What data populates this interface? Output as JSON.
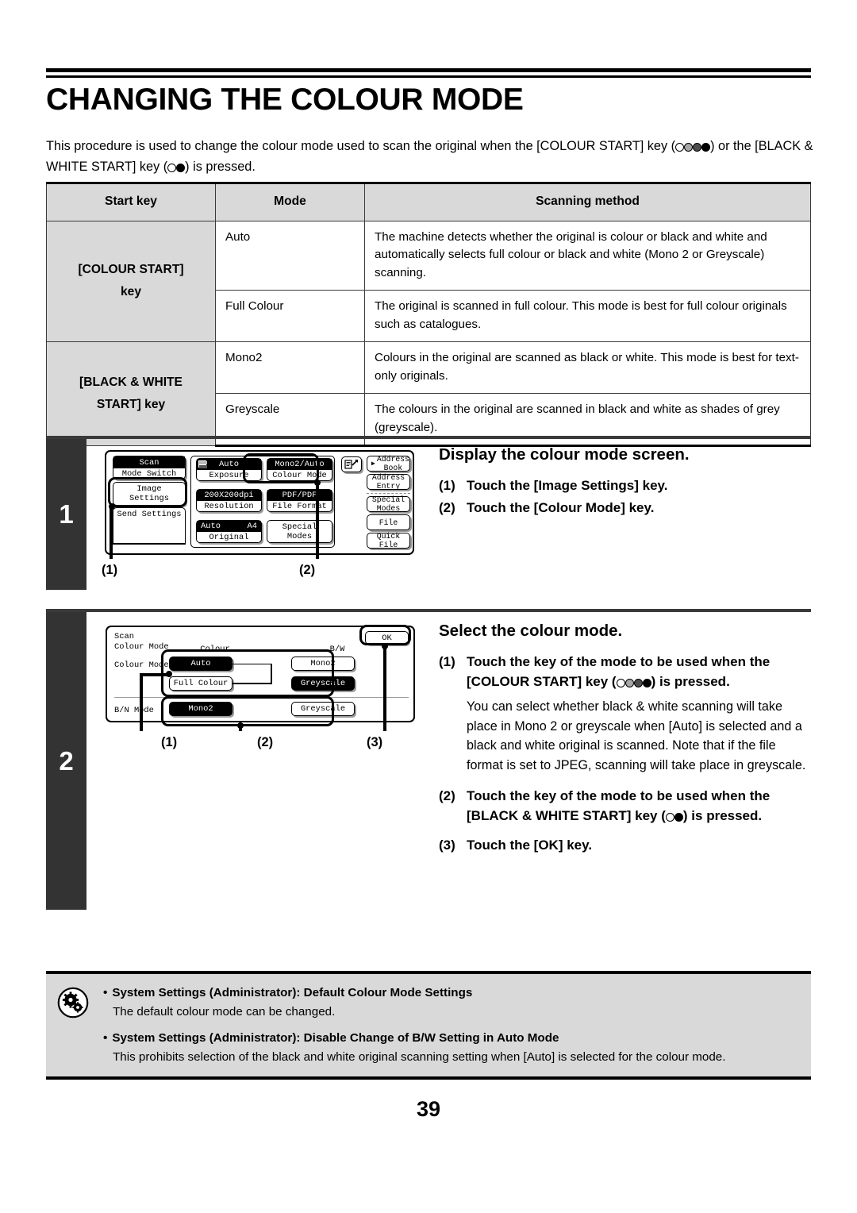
{
  "page": {
    "title": "CHANGING THE COLOUR MODE",
    "number": "39",
    "intro_a": "This procedure is used to change the colour mode used to scan the original when the [COLOUR START] key (",
    "intro_b": ") or the [BLACK & WHITE START] key (",
    "intro_c": ") is pressed."
  },
  "table": {
    "headers": [
      "Start key",
      "Mode",
      "Scanning method"
    ],
    "rows": [
      {
        "start_key": "[COLOUR START]\nkey",
        "start_key_line1": "[COLOUR START]",
        "start_key_line2": "key",
        "modes": [
          {
            "mode": "Auto",
            "method": "The machine detects whether the original is colour or black and white and automatically selects full colour or black and white (Mono 2 or Greyscale) scanning."
          },
          {
            "mode": "Full Colour",
            "method": "The original is scanned in full colour. This mode is best for full colour originals such as catalogues."
          }
        ]
      },
      {
        "start_key_line1": "[BLACK & WHITE",
        "start_key_line2": "START] key",
        "modes": [
          {
            "mode": "Mono2",
            "method": "Colours in the original are scanned as black or white. This mode is best for text-only originals."
          },
          {
            "mode": "Greyscale",
            "method": "The colours in the original are scanned in black and white as shades of grey (greyscale)."
          }
        ]
      }
    ]
  },
  "steps": [
    {
      "badge": "1",
      "heading": "Display the colour mode screen.",
      "items": [
        {
          "num": "(1)",
          "text": "Touch the [Image Settings] key."
        },
        {
          "num": "(2)",
          "text": "Touch the [Colour Mode] key."
        }
      ],
      "callouts": [
        "(1)",
        "(2)"
      ],
      "screen": {
        "left_keys": [
          {
            "top": "Scan",
            "bottom": "Mode Switch"
          },
          {
            "label_line1": "Image",
            "label_line2": "Settings"
          },
          {
            "label": "Send Settings"
          }
        ],
        "mid_keys": [
          {
            "top": "Auto",
            "bottom": "Exposure"
          },
          {
            "top": "Mono2/Auto",
            "bottom": "Colour Mode"
          },
          {
            "top": "200X200dpi",
            "bottom": "Resolution"
          },
          {
            "top": "PDF/PDF",
            "bottom": "File Format"
          },
          {
            "top_left": "Auto",
            "top_right": "A4",
            "bottom": "Original"
          },
          {
            "label": "Special Modes"
          }
        ],
        "right_keys": [
          "Address Book",
          "Address Entry",
          "Special Modes",
          "File",
          "Quick File"
        ]
      }
    },
    {
      "badge": "2",
      "heading": "Select the colour mode.",
      "items": [
        {
          "num": "(1)",
          "text": "Touch the key of the mode to be used when the [COLOUR START] key (○●●●) is pressed.",
          "text_a": "Touch the key of the mode to be used when the [COLOUR START] key (",
          "text_b": ") is pressed.",
          "body": "You can select whether black & white scanning will take place in Mono 2 or greyscale when [Auto] is selected and a black and white original is scanned. Note that if the file format is set to JPEG, scanning will take place in greyscale."
        },
        {
          "num": "(2)",
          "text_a": "Touch the key of the mode to be used when the [BLACK & WHITE START] key (",
          "text_b": ") is pressed."
        },
        {
          "num": "(3)",
          "text": "Touch the [OK] key."
        }
      ],
      "callouts": [
        "(1)",
        "(2)",
        "(3)"
      ],
      "screen": {
        "title_line1": "Scan",
        "title_line2": "Colour Mode",
        "ok": "OK",
        "col_headers": [
          "Colour",
          "B/W"
        ],
        "row1_label": "Colour Mode",
        "row2_label": "B/N Mode",
        "colour_keys": [
          {
            "label": "Auto",
            "selected": true
          },
          {
            "label": "Full Colour",
            "selected": false
          }
        ],
        "bw_keys": [
          {
            "label": "Mono2",
            "selected": false
          },
          {
            "label": "Greyscale",
            "selected": true
          }
        ],
        "bwmode_keys": [
          {
            "label": "Mono2",
            "selected": true
          },
          {
            "label": "Greyscale",
            "selected": false
          }
        ]
      }
    }
  ],
  "notes": [
    {
      "bold": "System Settings (Administrator): Default Colour Mode Settings",
      "body": "The default colour mode can be changed."
    },
    {
      "bold": "System Settings (Administrator): Disable Change of B/W Setting in Auto Mode",
      "body": "This prohibits selection of the black and white original scanning setting when [Auto] is selected for the colour mode."
    }
  ]
}
